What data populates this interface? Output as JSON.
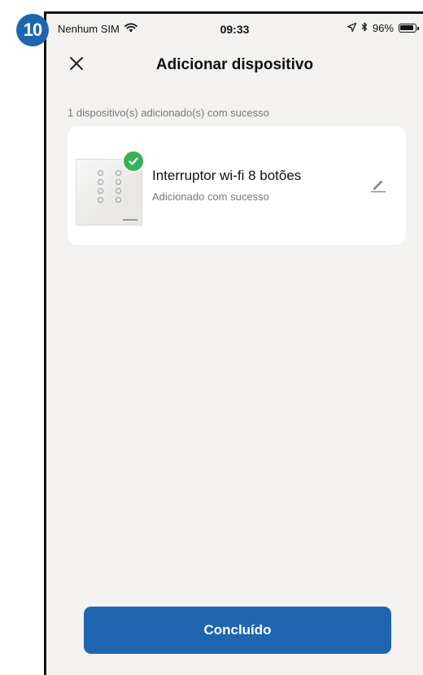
{
  "step_badge": "10",
  "status_bar": {
    "carrier": "Nenhum SIM",
    "time": "09:33",
    "battery": "96%",
    "icons": [
      "wifi-icon",
      "location-arrow-icon",
      "bluetooth-icon",
      "battery-icon"
    ]
  },
  "nav": {
    "title": "Adicionar dispositivo",
    "close_icon": "close-icon"
  },
  "success_message": "1 dispositivo(s) adicionado(s) com sucesso",
  "device": {
    "name": "Interruptor wi-fi 8 botões",
    "status": "Adicionado com sucesso",
    "badge_icon": "check-icon",
    "edit_icon": "pencil-icon"
  },
  "done_button": "Concluído",
  "colors": {
    "primary": "#1f65b0",
    "success": "#35b25a",
    "background": "#f3f2f0",
    "card": "#ffffff",
    "secondary_text": "#777777"
  }
}
